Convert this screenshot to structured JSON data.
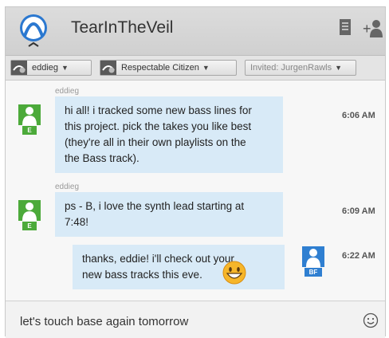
{
  "header": {
    "title": "TearInTheVeil",
    "icons": [
      "app-logo-icon",
      "notes-icon",
      "add-user-icon"
    ]
  },
  "participants": [
    {
      "name": "eddieg"
    },
    {
      "name": "Respectable Citizen"
    }
  ],
  "invited": "Invited: JurgenRawls",
  "messages": [
    {
      "sender": "eddieg",
      "initials": "E",
      "text": "hi all! i tracked some new bass lines for\nthis project. pick the takes you like best\n(they're all in their own playlists on the\nthe Bass track).",
      "time": "6:06 AM"
    },
    {
      "sender": "eddieg",
      "initials": "E",
      "text": "ps - B, i love the synth lead starting at\n7:48!",
      "time": "6:09 AM"
    },
    {
      "sender": "",
      "initials": "BF",
      "text": "thanks, eddie! i'll check out your\nnew bass tracks this eve.",
      "time": "6:22 AM"
    }
  ],
  "composer": {
    "value": "let's touch base again tomorrow",
    "emoji_icon": "smiley-icon"
  },
  "colors": {
    "bubble": "#d8eaf7",
    "avatar_e": "#4caa3a",
    "avatar_bf": "#2f7fd1",
    "logo_blue": "#2b78d0"
  }
}
